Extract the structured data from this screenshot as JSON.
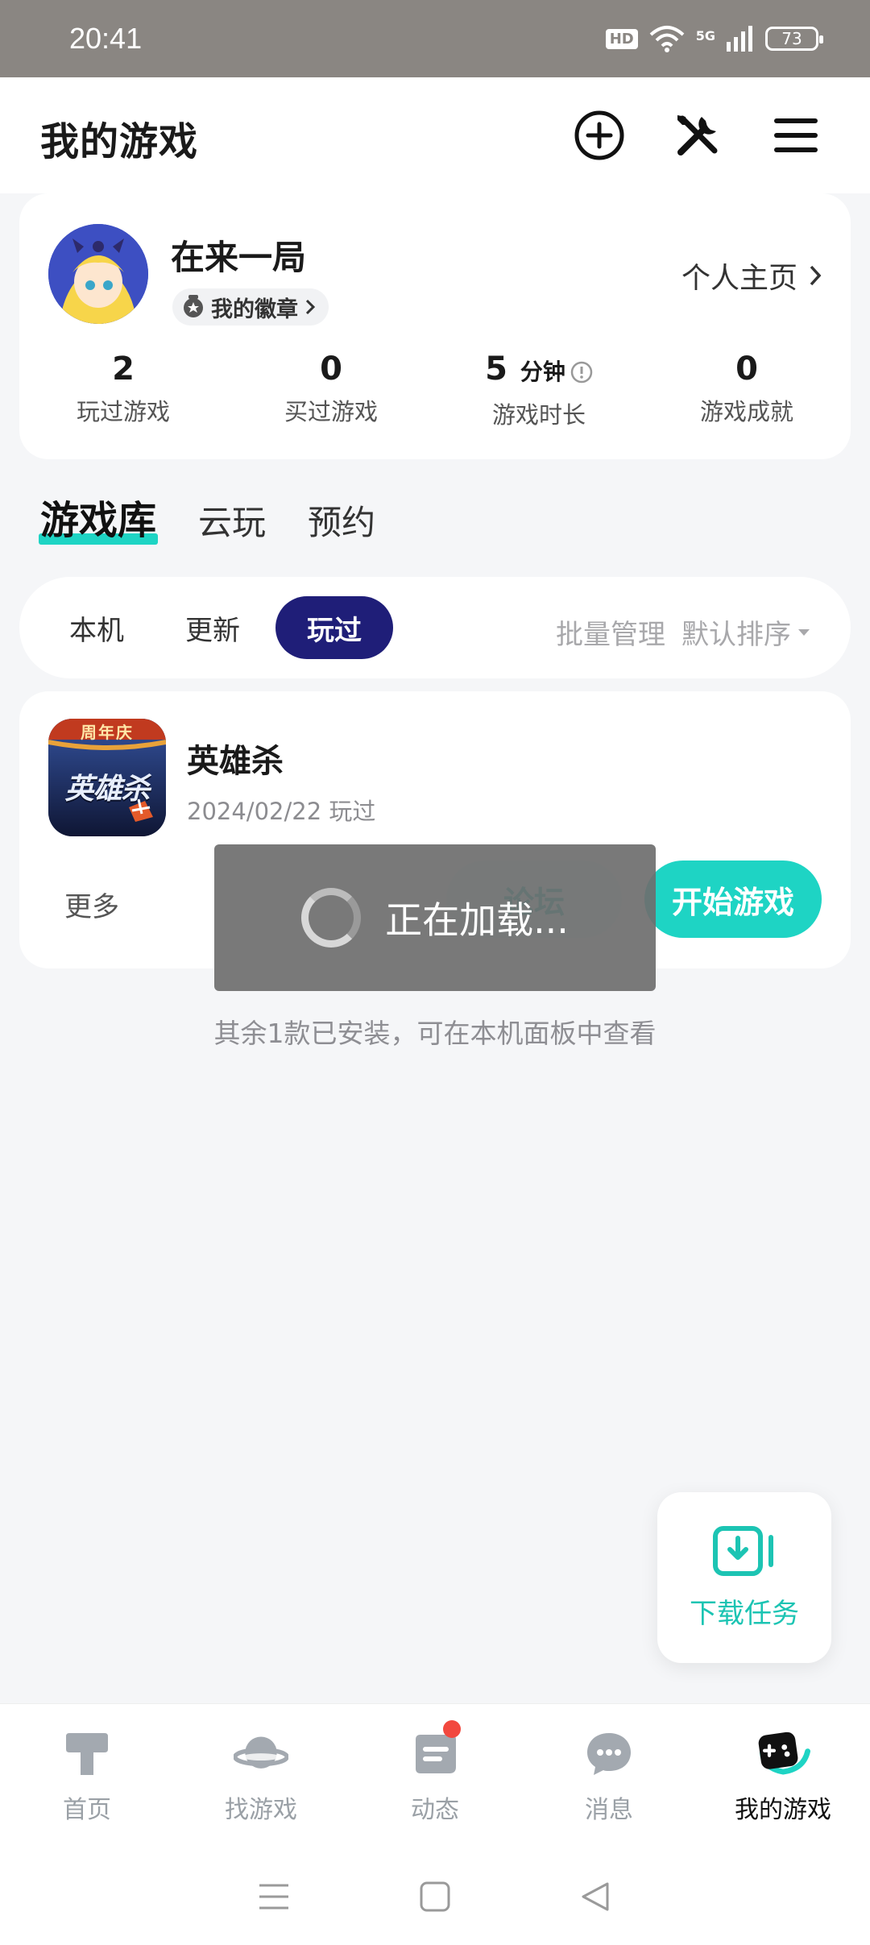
{
  "status_bar": {
    "time": "20:41",
    "hd": "HD",
    "network": "5G",
    "battery": "73"
  },
  "header": {
    "title": "我的游戏"
  },
  "profile": {
    "username": "在来一局",
    "badge_label": "我的徽章",
    "homepage_label": "个人主页",
    "stats": [
      {
        "value": "2",
        "label": "玩过游戏"
      },
      {
        "value": "0",
        "label": "买过游戏"
      },
      {
        "value": "5",
        "unit": "分钟",
        "label": "游戏时长"
      },
      {
        "value": "0",
        "label": "游戏成就"
      }
    ]
  },
  "library_tabs": [
    {
      "label": "游戏库",
      "active": true
    },
    {
      "label": "云玩",
      "active": false
    },
    {
      "label": "预约",
      "active": false
    }
  ],
  "filter": {
    "tabs": [
      {
        "label": "本机",
        "active": false
      },
      {
        "label": "更新",
        "active": false
      },
      {
        "label": "玩过",
        "active": true
      }
    ],
    "batch_manage": "批量管理",
    "sort": "默认排序"
  },
  "game": {
    "name": "英雄杀",
    "played_date": "2024/02/22 玩过",
    "icon_banner": "周年庆",
    "icon_title": "英雄杀",
    "more_label": "更多",
    "forum_label": "论坛",
    "start_label": "开始游戏"
  },
  "installed_note": "其余1款已安装，可在本机面板中查看",
  "loading": {
    "text": "正在加载..."
  },
  "download_fab": {
    "label": "下载任务"
  },
  "bottom_nav": [
    {
      "label": "首页",
      "icon": "home-icon",
      "active": false
    },
    {
      "label": "找游戏",
      "icon": "planet-icon",
      "active": false
    },
    {
      "label": "动态",
      "icon": "feed-icon",
      "active": false,
      "dot": true
    },
    {
      "label": "消息",
      "icon": "message-icon",
      "active": false
    },
    {
      "label": "我的游戏",
      "icon": "gamepad-icon",
      "active": true
    }
  ],
  "colors": {
    "accent": "#1ed4c4",
    "active_tab": "#1f1e78",
    "notification": "#f2483e"
  }
}
